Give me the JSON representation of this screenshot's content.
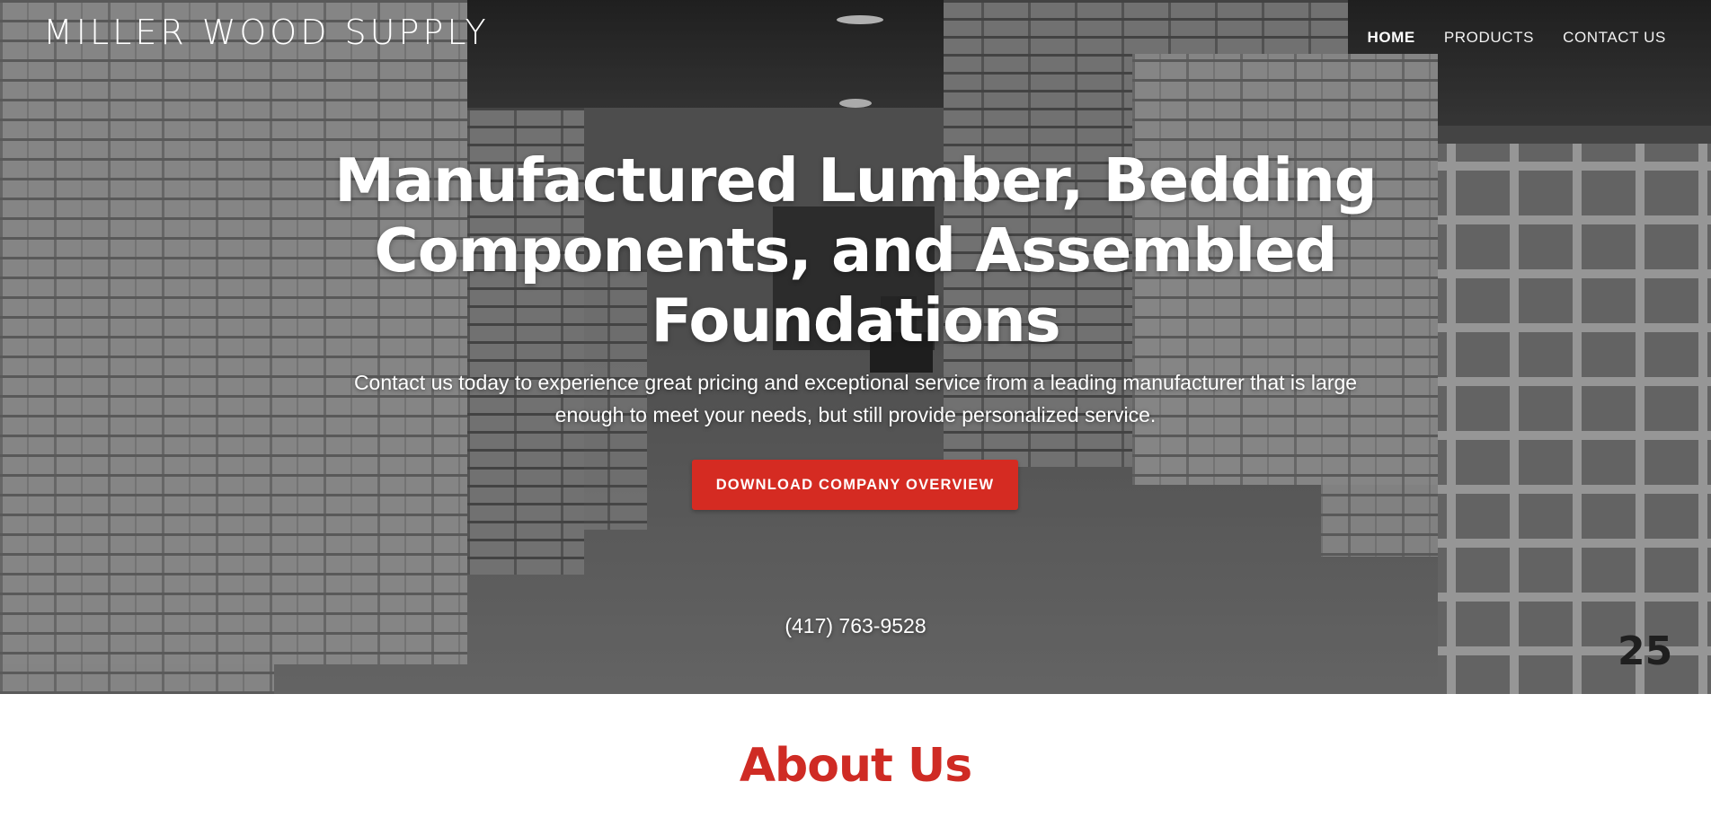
{
  "header": {
    "logo": "MILLER WOOD SUPPLY",
    "nav": [
      {
        "label": "HOME",
        "active": true
      },
      {
        "label": "PRODUCTS",
        "active": false
      },
      {
        "label": "CONTACT US",
        "active": false
      }
    ]
  },
  "hero": {
    "title_lines": [
      "Manufactured Lumber, Bedding",
      "Components, and Assembled",
      "Foundations"
    ],
    "subtitle_lines": [
      "Contact us today to experience great pricing and exceptional service from a leading manufacturer that is large",
      "enough to meet your needs, but still provide personalized service."
    ],
    "cta_label": "DOWNLOAD COMPANY OVERVIEW",
    "phone": "(417) 763-9528",
    "background_icon": "warehouse-lumber-photo"
  },
  "about": {
    "heading": "About Us"
  },
  "colors": {
    "accent": "#d52b22",
    "heading_red": "#cf2b24",
    "hero_text": "#ffffff"
  }
}
